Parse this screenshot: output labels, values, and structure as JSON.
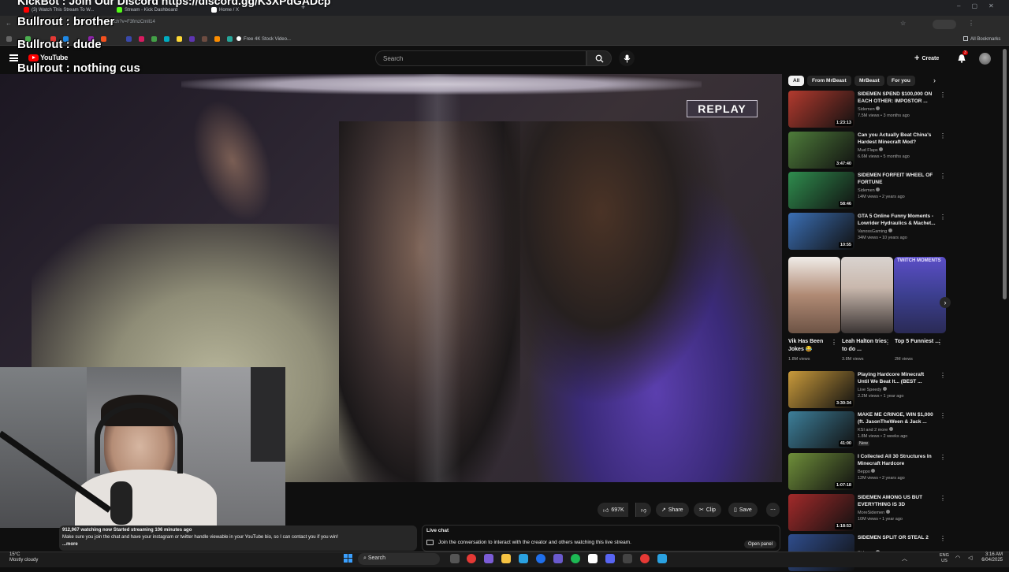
{
  "browser": {
    "tabs": [
      {
        "label": "(3) Watch This Stream To W...",
        "color": "#ff0000"
      },
      {
        "label": "Stream - Kick Dashboard",
        "color": "#53fc18"
      },
      {
        "label": "Home / X",
        "color": "#ffffff"
      }
    ],
    "url": "atch?v=F3fmzCmIl14",
    "bookmark_label": "Free 4K Stock Video...",
    "all_bookmarks": "All Bookmarks"
  },
  "overlay": {
    "top_partial": "KickBot : Join Our Discord  https://discord.gg/K3XPdGADcp",
    "messages": [
      "Bullrout : brother",
      "Bullrout : dude",
      "Bullrout : nothing cus"
    ]
  },
  "youtube": {
    "logo": "YouTube",
    "search_placeholder": "Search",
    "create_label": "Create",
    "notif_count": "3"
  },
  "player": {
    "replay_label": "REPLAY"
  },
  "actions": {
    "likes": "697K",
    "share": "Share",
    "clip": "Clip",
    "save": "Save"
  },
  "description": {
    "stats": "912,967 watching now  Started streaming 106 minutes ago",
    "text": "Make sure you join the chat and have your instagram or twitter handle viewable in your YouTube bio, so I can contact you if you win!",
    "more": "...more"
  },
  "livechat": {
    "title": "Live chat",
    "prompt": "Join the conversation to interact with the creator and others watching this live stream.",
    "open_panel": "Open panel"
  },
  "chips": [
    "All",
    "From MrBeast",
    "MrBeast",
    "For you"
  ],
  "videos_top": [
    {
      "title": "SIDEMEN SPEND $100,000 ON EACH OTHER: IMPOSTOR ...",
      "channel": "Sidemen",
      "meta": "7.5M views • 3 months ago",
      "duration": "1:23:13",
      "color": "#b33a2e"
    },
    {
      "title": "Can you Actually Beat China's Hardest Minecraft Mod?",
      "channel": "Mud Flaps",
      "meta": "6.6M views • 5 months ago",
      "duration": "3:47:40",
      "color": "#4e7c3a"
    },
    {
      "title": "SIDEMEN FORFEIT WHEEL OF FORTUNE",
      "channel": "Sidemen",
      "meta": "14M views • 2 years ago",
      "duration": "58:46",
      "color": "#2f8d4e"
    },
    {
      "title": "GTA 5 Online Funny Moments - Lowrider Hydraulics & Machet...",
      "channel": "VanossGaming",
      "meta": "34M views • 10 years ago",
      "duration": "10:55",
      "color": "#3b6fb5"
    }
  ],
  "shorts": [
    {
      "title": "Vik Has Been Jokes 😂",
      "views": "1.8M views",
      "color": "#8a6b5a"
    },
    {
      "title": "Leah Halton tries to do ...",
      "views": "3.8M views",
      "color": "#c9b8ad"
    },
    {
      "title": "Top 5 Funniest ...",
      "views": "2M views",
      "color": "#3c3f8f"
    }
  ],
  "shorts_overlay_label": "TWITCH MOMENTS",
  "videos_bottom": [
    {
      "title": "Playing Hardcore Minecraft Until We Beat It... (BEST ...",
      "channel": "Live Speedy",
      "meta": "2.2M views • 1 year ago",
      "duration": "3:30:34",
      "color": "#c99a3b"
    },
    {
      "title": "MAKE ME CRINGE, WIN $1,000 (ft. JasonTheWeen & Jack ...",
      "channel": "KSI and 2 more",
      "meta": "1.8M views • 2 weeks ago",
      "duration": "41:00",
      "badge": "New",
      "color": "#3d7f9a"
    },
    {
      "title": "I Collected All 30 Structures In Minecraft Hardcore",
      "channel": "Beppo",
      "meta": "12M views • 2 years ago",
      "duration": "1:07:18",
      "color": "#6f8f3a"
    },
    {
      "title": "SIDEMEN AMONG US BUT EVERYTHING IS 3D",
      "channel": "MoreSidemen",
      "meta": "10M views • 1 year ago",
      "duration": "1:18:53",
      "color": "#a32a2a"
    },
    {
      "title": "SIDEMEN SPLIT OR STEAL 2",
      "channel": "Sidemen",
      "meta": "",
      "duration": "",
      "color": "#2f4d8d"
    }
  ],
  "taskbar": {
    "weather_temp": "15°C",
    "weather_desc": "Mostly cloudy",
    "search": "Search",
    "lang1": "ENG",
    "lang2": "US",
    "time": "3:16 AM",
    "date": "6/04/2025"
  }
}
